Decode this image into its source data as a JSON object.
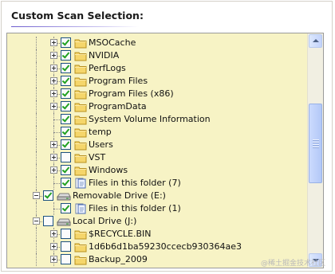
{
  "header": {
    "title": "Custom Scan Selection:"
  },
  "tree": {
    "rows": [
      {
        "label": "MSOCache",
        "icon": "folder-icon",
        "checked": true,
        "expander": "plus"
      },
      {
        "label": "NVIDIA",
        "icon": "folder-icon",
        "checked": true,
        "expander": "plus"
      },
      {
        "label": "PerfLogs",
        "icon": "folder-icon",
        "checked": true,
        "expander": "plus"
      },
      {
        "label": "Program Files",
        "icon": "folder-icon",
        "checked": true,
        "expander": "plus"
      },
      {
        "label": "Program Files (x86)",
        "icon": "folder-icon",
        "checked": true,
        "expander": "plus"
      },
      {
        "label": "ProgramData",
        "icon": "folder-icon",
        "checked": true,
        "expander": "plus"
      },
      {
        "label": "System Volume Information",
        "icon": "folder-icon",
        "checked": true,
        "expander": "none"
      },
      {
        "label": "temp",
        "icon": "folder-icon",
        "checked": true,
        "expander": "none"
      },
      {
        "label": "Users",
        "icon": "folder-icon",
        "checked": true,
        "expander": "plus"
      },
      {
        "label": "VST",
        "icon": "folder-icon",
        "checked": false,
        "expander": "plus"
      },
      {
        "label": "Windows",
        "icon": "folder-icon",
        "checked": true,
        "expander": "plus"
      },
      {
        "label": "Files in this folder (7)",
        "icon": "files-icon",
        "checked": true,
        "expander": "none"
      },
      {
        "label": "Removable Drive (E:)",
        "icon": "drive-icon",
        "checked": true,
        "expander": "minus"
      },
      {
        "label": "Files in this folder (1)",
        "icon": "files-icon",
        "checked": true,
        "expander": "none"
      },
      {
        "label": "Local Drive (J:)",
        "icon": "drive-icon",
        "checked": false,
        "expander": "minus"
      },
      {
        "label": "$RECYCLE.BIN",
        "icon": "folder-icon",
        "checked": false,
        "expander": "plus"
      },
      {
        "label": "1d6b6d1ba59230ccecb930364ae3",
        "icon": "folder-icon",
        "checked": false,
        "expander": "plus"
      },
      {
        "label": "Backup_2009",
        "icon": "folder-icon",
        "checked": false,
        "expander": "plus"
      }
    ]
  },
  "watermark": "@稀土掘金技术社区",
  "colors": {
    "tree_background": "#f7f3c5",
    "checkmark": "#21a121",
    "title_rule": "#6a5acd"
  }
}
